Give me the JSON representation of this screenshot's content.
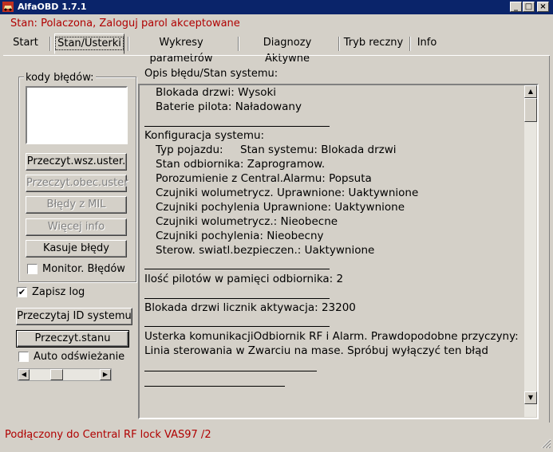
{
  "window": {
    "title": "AlfaOBD 1.7.1",
    "min_glyph": "_",
    "max_glyph": "□",
    "close_glyph": "×"
  },
  "status_line": "Stan: Polaczona, Zaloguj parol akceptowane",
  "tabs": [
    {
      "label": "Start"
    },
    {
      "label": "Stan/Usterki"
    },
    {
      "label": "Wykresy parametrów"
    },
    {
      "label": "Diagnozy Aktywne"
    },
    {
      "label": "Tryb reczny"
    },
    {
      "label": "Info"
    }
  ],
  "left_panel": {
    "codes_label": "kody błędów:",
    "buttons": {
      "read_all": "Przeczyt.wsz.uster.",
      "read_current": "Przeczyt.obec.uster",
      "mil_errors": "Błędy z MIL",
      "more_info": "Więcej info",
      "clear_errors": "Kasuje błędy"
    },
    "monitor_errors": {
      "label": "Monitor. Błędów",
      "checked": false
    },
    "save_log": {
      "label": "Zapisz log",
      "checked": true
    },
    "read_system_id": "Przeczytaj ID systemu",
    "read_state": "Przeczyt.stanu",
    "auto_refresh": {
      "label": "Auto odświeżanie",
      "checked": false
    },
    "check_glyph": "✔",
    "left_arrow": "◀",
    "right_arrow": "▶"
  },
  "main": {
    "heading": "Opis błędu/Stan systemu:",
    "lines": [
      "Blokada drzwi: Wysoki",
      "Baterie pilota: Naładowany",
      "Konfiguracja systemu:",
      "Typ pojazdu:     Stan systemu: Blokada drzwi",
      "Stan odbiornika: Zaprogramow.",
      "Porozumienie z Central.Alarmu: Popsuta",
      "Czujniki wolumetrycz. Uprawnione: Uaktywnione",
      "Czujniki pochylenia Uprawnione: Uaktywnione",
      "Czujniki wolumetrycz.: Nieobecne",
      "Czujniki pochylenia: Nieobecny",
      "Sterow. swiatl.bezpieczen.: Uaktywnione",
      "Ilość pilotów w pamięci odbiornika: 2",
      "Blokada drzwi licznik aktywacja: 23200",
      "Usterka komunikacjiOdbiornik RF i Alarm. Prawdopodobne przyczyny:",
      "Linia sterowania w Zwarciu na mase. Spróbuj wyłączyć ten błąd"
    ],
    "up_arrow": "▲",
    "down_arrow": "▼"
  },
  "footer_status": "Podłączony do Central RF lock VAS97 /2"
}
